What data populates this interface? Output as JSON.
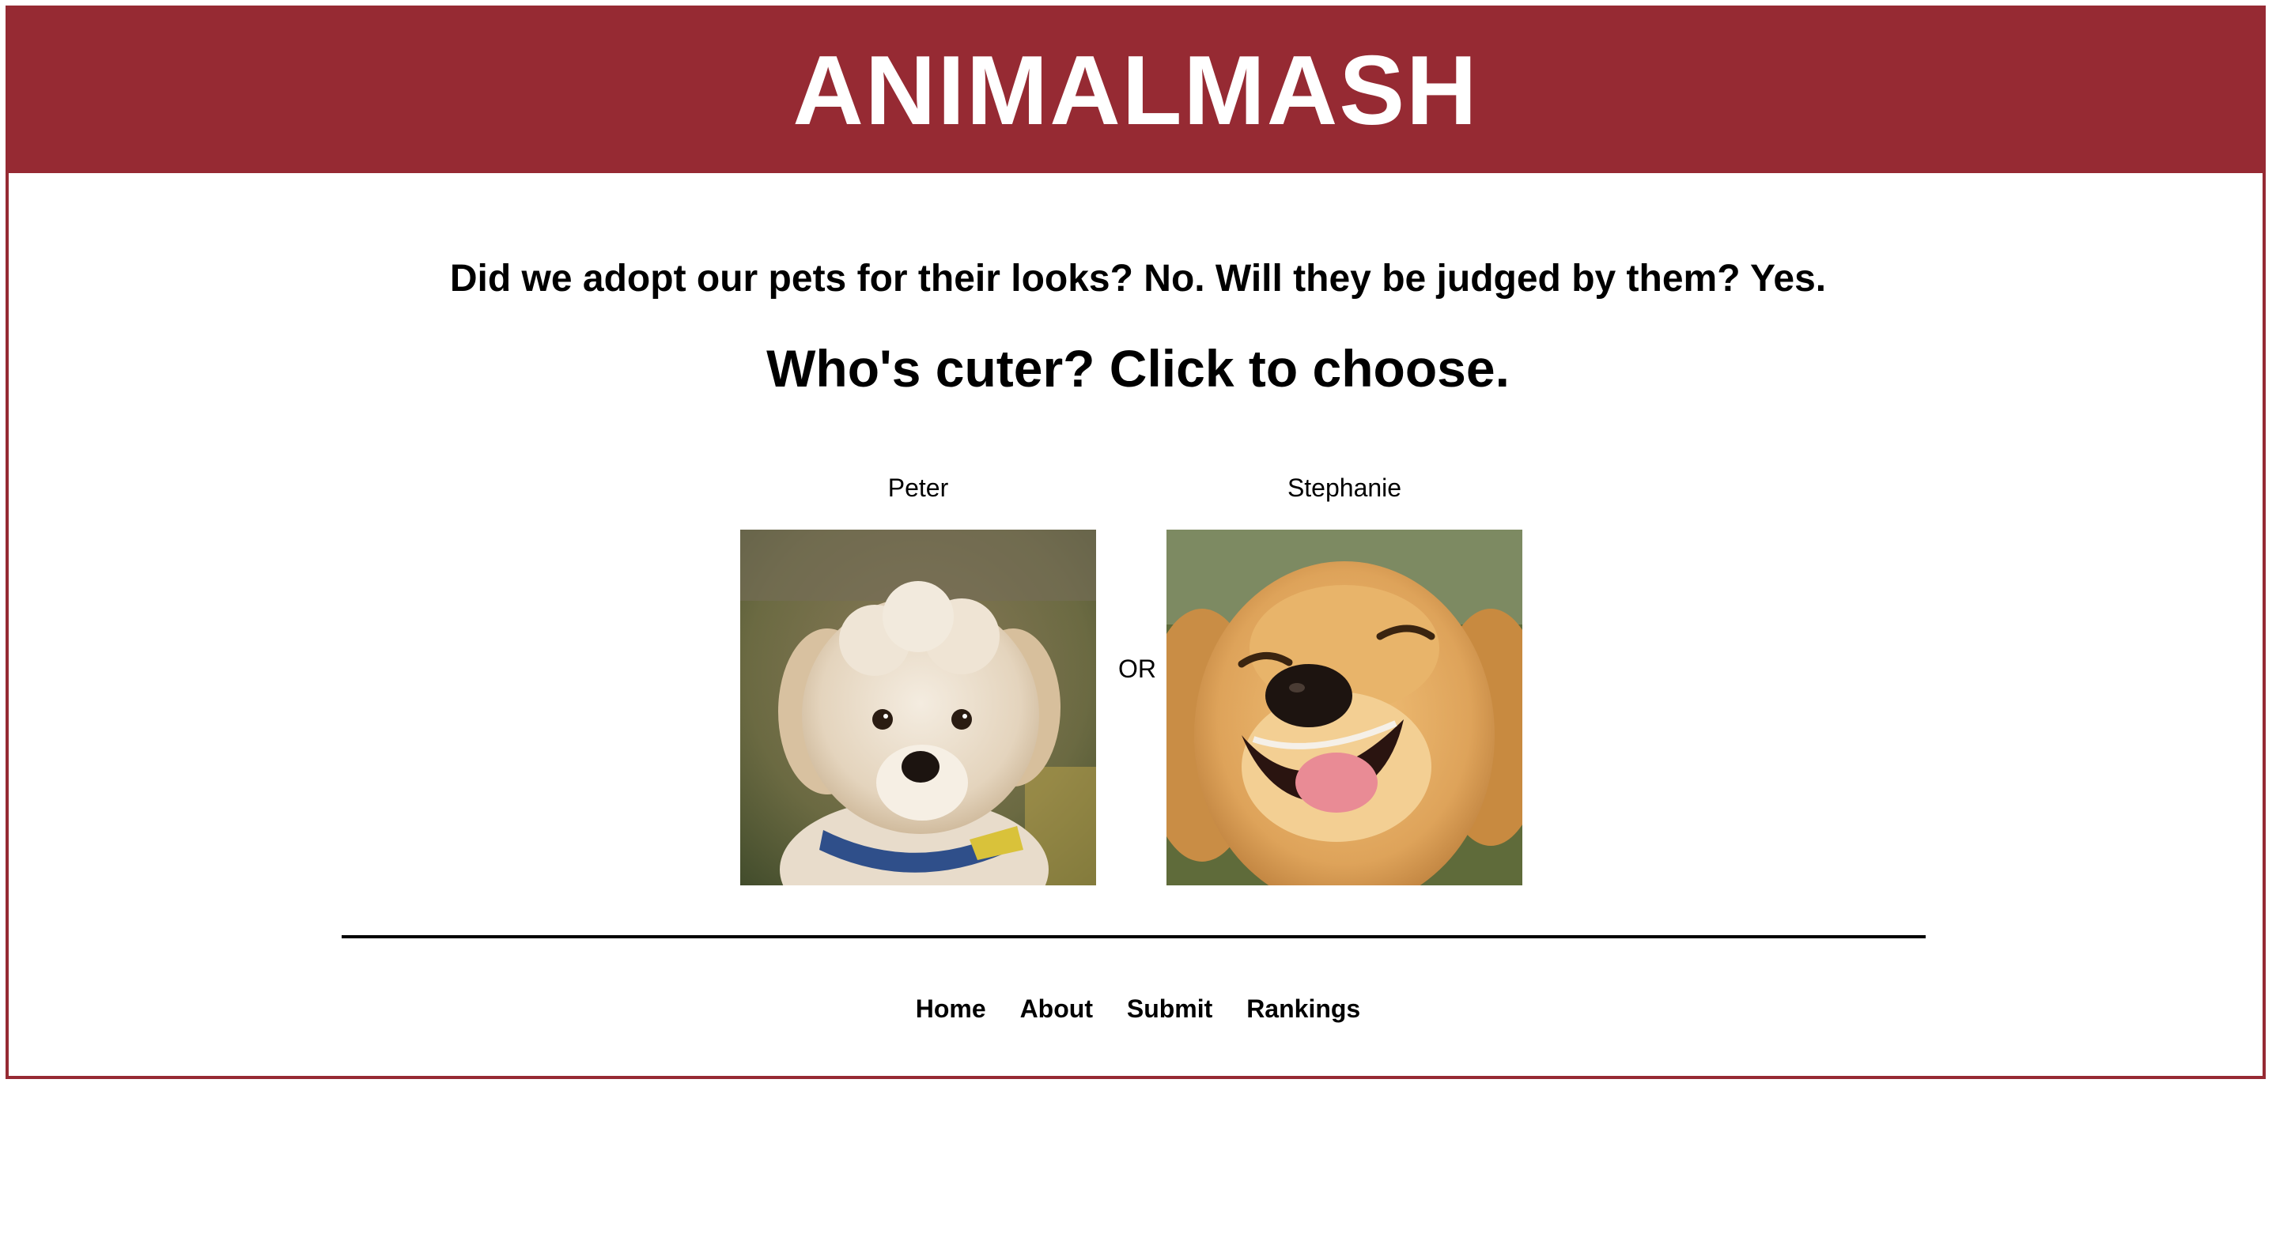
{
  "header": {
    "title": "ANIMALMASH",
    "background_color": "#962a33"
  },
  "main": {
    "tagline": "Did we adopt our pets for their looks? No. Will they be judged by them? Yes.",
    "prompt": "Who's cuter? Click to choose.",
    "separator": "OR",
    "contestants": [
      {
        "name": "Peter",
        "photo_icon": "poodle-puppy-photo"
      },
      {
        "name": "Stephanie",
        "photo_icon": "golden-retriever-photo"
      }
    ]
  },
  "footer": {
    "links": [
      {
        "label": "Home"
      },
      {
        "label": "About"
      },
      {
        "label": "Submit"
      },
      {
        "label": "Rankings"
      }
    ]
  }
}
